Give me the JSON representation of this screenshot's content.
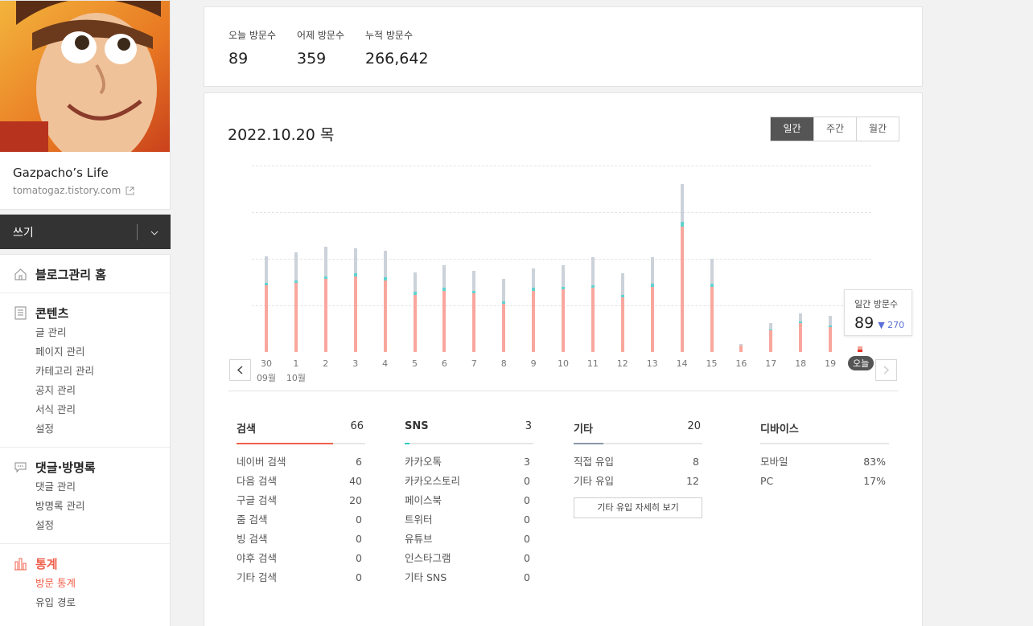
{
  "sidebar": {
    "blog_name": "Gazpacho’s Life",
    "blog_url": "tomatogaz.tistory.com",
    "write_label": "쓰기",
    "menu": {
      "home": "블로그관리 홈",
      "contents": {
        "label": "콘텐츠",
        "items": [
          "글 관리",
          "페이지 관리",
          "카테고리 관리",
          "공지 관리",
          "서식 관리",
          "설정"
        ]
      },
      "comments": {
        "label": "댓글·방명록",
        "items": [
          "댓글 관리",
          "방명록 관리",
          "설정"
        ]
      },
      "stats": {
        "label": "통계",
        "items": [
          "방문 통계",
          "유입 경로"
        ]
      }
    }
  },
  "summary": {
    "today_label": "오늘 방문수",
    "today_value": "89",
    "yesterday_label": "어제 방문수",
    "yesterday_value": "359",
    "total_label": "누적 방문수",
    "total_value": "266,642"
  },
  "main": {
    "date_title": "2022.10.20 목",
    "tabs": [
      "일간",
      "주간",
      "월간"
    ],
    "active_tab": "일간",
    "tooltip": {
      "label": "일간 방문수",
      "value": "89",
      "diff": "▼ 270"
    },
    "today_badge": "오늘"
  },
  "chart_data": {
    "type": "bar",
    "stacked": true,
    "categories": [
      "30",
      "1",
      "2",
      "3",
      "4",
      "5",
      "6",
      "7",
      "8",
      "9",
      "10",
      "11",
      "12",
      "13",
      "14",
      "15",
      "16",
      "17",
      "18",
      "19",
      "20"
    ],
    "month_labels": [
      {
        "index": 0,
        "text": "09월"
      },
      {
        "index": 1,
        "text": "10월"
      }
    ],
    "series": [
      {
        "name": "검색",
        "color": "#f9a79e",
        "values": [
          250,
          260,
          275,
          285,
          270,
          215,
          230,
          220,
          180,
          230,
          235,
          240,
          205,
          245,
          470,
          245,
          25,
          80,
          110,
          95,
          10
        ]
      },
      {
        "name": "SNS",
        "color": "#5fd3d0",
        "values": [
          10,
          10,
          10,
          10,
          10,
          10,
          10,
          10,
          10,
          10,
          10,
          10,
          10,
          10,
          20,
          10,
          0,
          5,
          5,
          5,
          0
        ]
      },
      {
        "name": "기타",
        "color": "#ccd2d9",
        "values": [
          100,
          105,
          110,
          95,
          100,
          75,
          85,
          75,
          85,
          75,
          80,
          105,
          80,
          100,
          140,
          95,
          5,
          25,
          30,
          35,
          10
        ]
      }
    ],
    "ylim": [
      0,
      700
    ],
    "grid": true,
    "xlabel": "",
    "ylabel": ""
  },
  "referrers": {
    "search": {
      "label": "검색",
      "total": "66",
      "color": "#f0604b",
      "fill": 0.75,
      "rows": [
        [
          "네이버 검색",
          "6"
        ],
        [
          "다음 검색",
          "40"
        ],
        [
          "구글 검색",
          "20"
        ],
        [
          "줌 검색",
          "0"
        ],
        [
          "빙 검색",
          "0"
        ],
        [
          "야후 검색",
          "0"
        ],
        [
          "기타 검색",
          "0"
        ]
      ]
    },
    "sns": {
      "label": "SNS",
      "total": "3",
      "color": "#2ec9c4",
      "fill": 0.04,
      "rows": [
        [
          "카카오톡",
          "3"
        ],
        [
          "카카오스토리",
          "0"
        ],
        [
          "페이스북",
          "0"
        ],
        [
          "트위터",
          "0"
        ],
        [
          "유튜브",
          "0"
        ],
        [
          "인스타그램",
          "0"
        ],
        [
          "기타 SNS",
          "0"
        ]
      ]
    },
    "etc": {
      "label": "기타",
      "total": "20",
      "color": "#8c97a8",
      "fill": 0.23,
      "rows": [
        [
          "직접 유입",
          "8"
        ],
        [
          "기타 유입",
          "12"
        ]
      ],
      "detail_button": "기타 유입 자세히 보기"
    },
    "device": {
      "label": "디바이스",
      "rows": [
        [
          "모바일",
          "83%"
        ],
        [
          "PC",
          "17%"
        ]
      ]
    }
  }
}
